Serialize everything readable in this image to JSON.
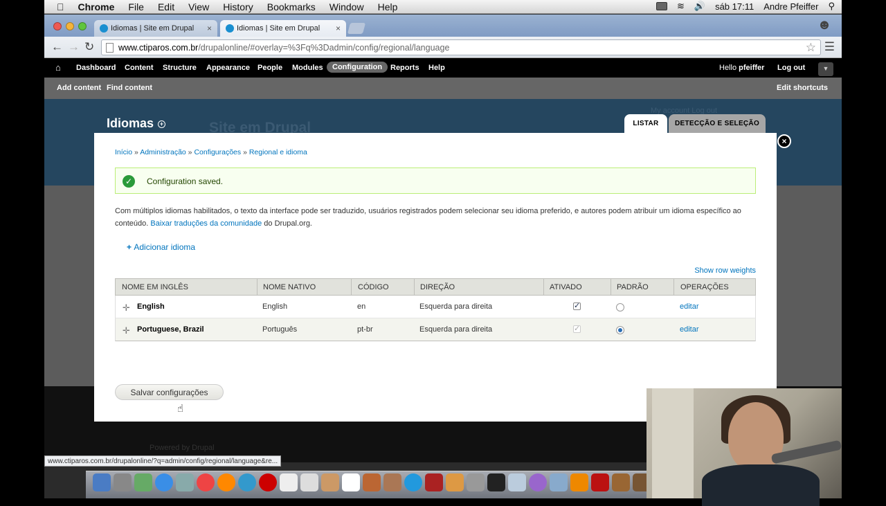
{
  "menubar": {
    "apple": "",
    "app": "Chrome",
    "items": [
      "File",
      "Edit",
      "View",
      "History",
      "Bookmarks",
      "Window",
      "Help"
    ],
    "clock": "sáb 17:11",
    "user": "Andre Pfeiffer"
  },
  "browser": {
    "tabs": [
      {
        "title": "Idiomas | Site em Drupal"
      },
      {
        "title": "Idiomas | Site em Drupal"
      }
    ],
    "url_host": "www.ctiparos.com.br",
    "url_path": "/drupalonline/#overlay=%3Fq%3Dadmin/config/regional/language",
    "status_url": "www.ctiparos.com.br/drupalonline/?q=admin/config/regional/language&re..."
  },
  "drupal_toolbar": {
    "items": [
      "Dashboard",
      "Content",
      "Structure",
      "Appearance",
      "People",
      "Modules",
      "Configuration",
      "Reports",
      "Help"
    ],
    "active": "Configuration",
    "hello": "Hello",
    "username": "pfeiffer",
    "logout": "Log out"
  },
  "shortcuts": {
    "add_content": "Add content",
    "find_content": "Find content",
    "edit": "Edit shortcuts"
  },
  "background": {
    "site_name": "Site em Drupal",
    "account_links": "My account   Log out",
    "powered": "Powered by Drupal"
  },
  "overlay": {
    "title": "Idiomas",
    "tabs": [
      "LISTAR",
      "DETECÇÃO E SELEÇÃO"
    ],
    "breadcrumb": [
      "Início",
      "Administração",
      "Configurações",
      "Regional e idioma"
    ],
    "message": "Configuration saved.",
    "desc_before": "Com múltiplos idiomas habilitados, o texto da interface pode ser traduzido, usuários registrados podem selecionar seu idioma preferido, e autores podem atribuir um idioma específico ao conteúdo.",
    "desc_link": "Baixar traduções da comunidade",
    "desc_after": "do Drupal.org.",
    "add_language": "Adicionar idioma",
    "show_row_weights": "Show row weights",
    "columns": [
      "NOME EM INGLÊS",
      "NOME NATIVO",
      "CÓDIGO",
      "DIREÇÃO",
      "ATIVADO",
      "PADRÃO",
      "OPERAÇÕES"
    ],
    "rows": [
      {
        "english": "English",
        "native": "English",
        "code": "en",
        "direction": "Esquerda para direita",
        "enabled": true,
        "default": false,
        "op": "editar"
      },
      {
        "english": "Portuguese, Brazil",
        "native": "Português",
        "code": "pt-br",
        "direction": "Esquerda para direita",
        "enabled": true,
        "default": true,
        "op": "editar"
      }
    ],
    "save_label": "Salvar configurações"
  }
}
